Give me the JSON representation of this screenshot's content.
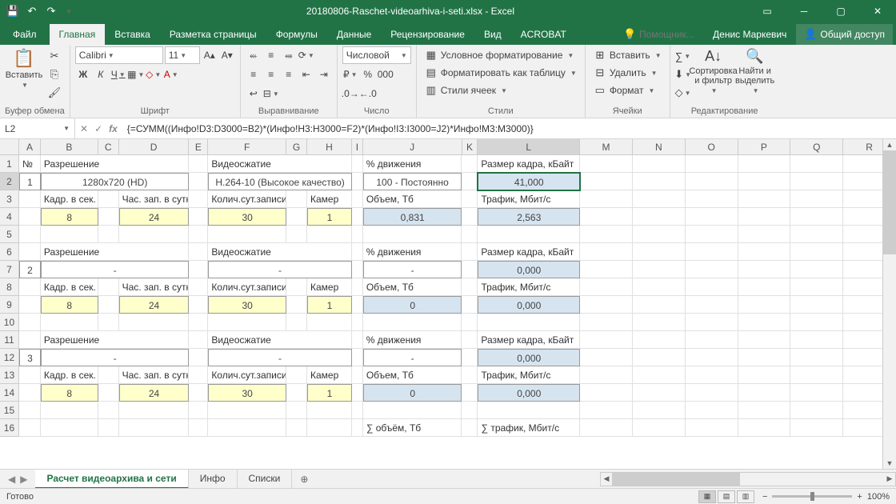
{
  "title": "20180806-Raschet-videoarhiva-i-seti.xlsx - Excel",
  "tabs": {
    "file": "Файл",
    "home": "Главная",
    "insert": "Вставка",
    "layout": "Разметка страницы",
    "formulas": "Формулы",
    "data": "Данные",
    "review": "Рецензирование",
    "view": "Вид",
    "acrobat": "ACROBAT"
  },
  "tellme": "Помощник...",
  "user": "Денис Маркевич",
  "share": "Общий доступ",
  "ribbon": {
    "clipboard": {
      "paste": "Вставить",
      "label": "Буфер обмена"
    },
    "font": {
      "name": "Calibri",
      "size": "11",
      "label": "Шрифт"
    },
    "align": {
      "label": "Выравнивание"
    },
    "number": {
      "format": "Числовой",
      "label": "Число"
    },
    "styles": {
      "cond": "Условное форматирование",
      "table": "Форматировать как таблицу",
      "cell": "Стили ячеек",
      "label": "Стили"
    },
    "cells": {
      "insert": "Вставить",
      "delete": "Удалить",
      "format": "Формат",
      "label": "Ячейки"
    },
    "editing": {
      "sort": "Сортировка и фильтр",
      "find": "Найти и выделить",
      "label": "Редактирование"
    }
  },
  "nameBox": "L2",
  "formula": "{=СУММ((Инфо!D3:D3000=B2)*(Инфо!H3:H3000=F2)*(Инфо!I3:I3000=J2)*Инфо!M3:M3000)}",
  "cols": [
    "A",
    "B",
    "C",
    "D",
    "E",
    "F",
    "G",
    "H",
    "I",
    "J",
    "K",
    "L",
    "M",
    "N",
    "O",
    "P",
    "Q",
    "R"
  ],
  "headers": {
    "num": "№",
    "res": "Разрешение",
    "codec": "Видеосжатие",
    "motion": "% движения",
    "frame": "Размер кадра, кБайт",
    "fps": "Кадр. в сек.",
    "hours": "Час. зап. в сутки",
    "days": "Колич.сут.записи",
    "cams": "Камер",
    "volume": "Объем, Тб",
    "traffic": "Трафик, Мбит/с",
    "sumVol": "∑ объём, Тб",
    "sumTraf": "∑ трафик, Мбит/с"
  },
  "block1": {
    "num": "1",
    "res": "1280x720 (HD)",
    "codec": "H.264-10 (Высокое качество)",
    "motion": "100 - Постоянно",
    "frame": "41,000",
    "fps": "8",
    "hours": "24",
    "days": "30",
    "cams": "1",
    "volume": "0,831",
    "traffic": "2,563"
  },
  "block2": {
    "num": "2",
    "res": "-",
    "codec": "-",
    "motion": "-",
    "frame": "0,000",
    "fps": "8",
    "hours": "24",
    "days": "30",
    "cams": "1",
    "volume": "0",
    "traffic": "0,000"
  },
  "block3": {
    "num": "3",
    "res": "-",
    "codec": "-",
    "motion": "-",
    "frame": "0,000",
    "fps": "8",
    "hours": "24",
    "days": "30",
    "cams": "1",
    "volume": "0",
    "traffic": "0,000"
  },
  "sheets": {
    "s1": "Расчет видеоархива и сети",
    "s2": "Инфо",
    "s3": "Списки"
  },
  "status": "Готово",
  "zoom": "100%"
}
